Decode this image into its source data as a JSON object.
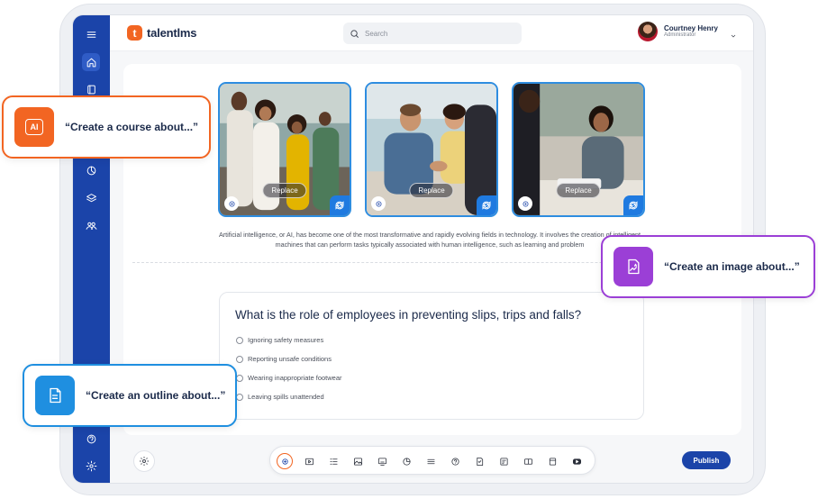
{
  "brand": {
    "name": "talentlms",
    "mark": "t",
    "accent": "#f26522",
    "primary": "#1b44a9"
  },
  "header": {
    "search_placeholder": "Search",
    "user_name": "Courtney Henry",
    "user_role": "Administrator"
  },
  "sidebar": {
    "items": [
      {
        "icon": "menu-icon"
      },
      {
        "icon": "home-icon"
      },
      {
        "icon": "book-icon"
      },
      {
        "icon": "reports-icon"
      },
      {
        "icon": "layers-icon"
      },
      {
        "icon": "users-icon"
      },
      {
        "icon": "support-icon"
      },
      {
        "icon": "gear-icon"
      }
    ]
  },
  "images": [
    {
      "replace_label": "Replace"
    },
    {
      "replace_label": "Replace"
    },
    {
      "replace_label": "Replace"
    }
  ],
  "paragraph": "Artificial intelligence, or AI, has become one of the most transformative and rapidly evolving fields in technology. It involves the creation of intelligent machines that can perform tasks typically associated with human intelligence, such as learning and problem",
  "question": {
    "title": "What is the role of employees in preventing slips, trips and falls?",
    "options": [
      "Ignoring safety measures",
      "Reporting unsafe conditions",
      "Wearing inappropriate footwear",
      "Leaving spills unattended"
    ]
  },
  "toolbar": {
    "tools": [
      "ai-icon",
      "video-icon",
      "list-icon",
      "image-icon",
      "presentation-icon",
      "pie-chart-icon",
      "divider-icon",
      "question-icon",
      "assignment-icon",
      "survey-icon",
      "scorm-icon",
      "file-icon",
      "youtube-icon"
    ],
    "publish_label": "Publish"
  },
  "prompts": {
    "course": {
      "text": "“Create a course about...”",
      "icon_label": "AI",
      "color": "#f26522"
    },
    "image": {
      "text": "“Create an image about...”",
      "color": "#9b3fd6"
    },
    "outline": {
      "text": "“Create an outline about...”",
      "color": "#1f8fe0"
    }
  }
}
